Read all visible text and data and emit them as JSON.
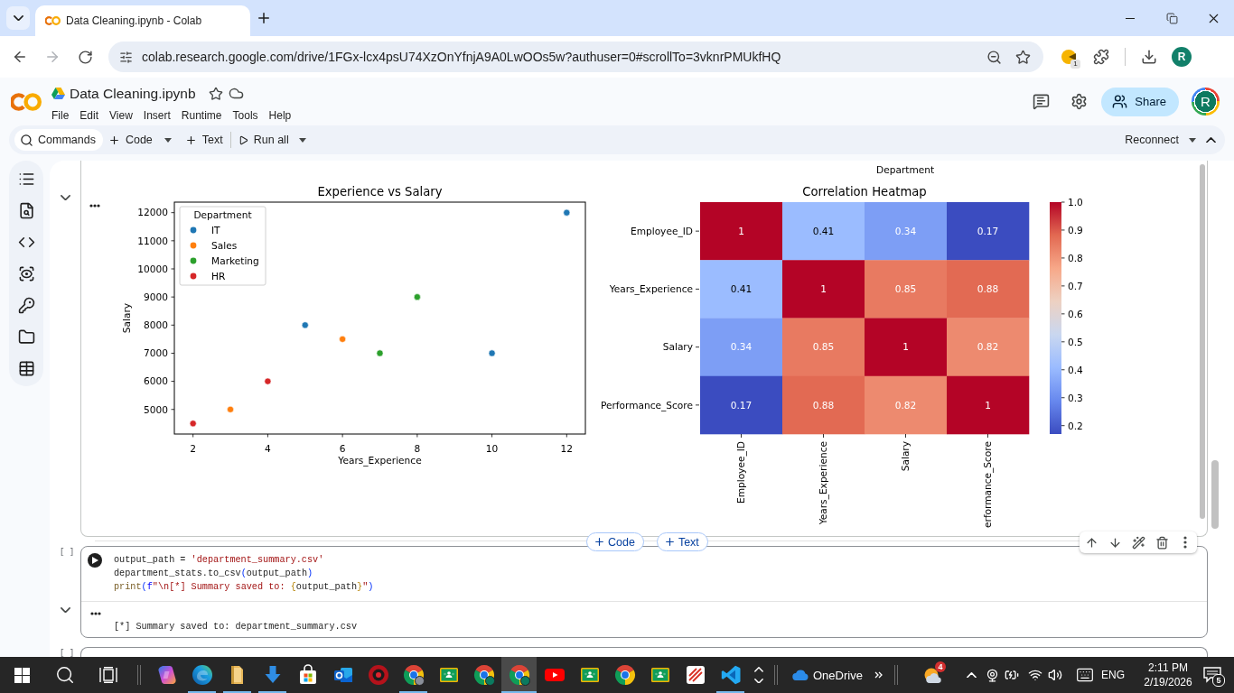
{
  "browser": {
    "tabs": [
      {
        "title": "Data Cleaning.ipynb - Colab",
        "selected": true
      }
    ],
    "can_go_forward": false,
    "url": "colab.research.google.com/drive/1FGx-lcx4psU74XzOnYfnjA9A0LwOOs5w?authuser=0#scrollTo=3vknrPMUkfHQ",
    "url_starred": false,
    "extension_badge": "1",
    "profile_initial": "R"
  },
  "header": {
    "title": "Data Cleaning.ipynb",
    "starred": false,
    "menu": [
      "File",
      "Edit",
      "View",
      "Insert",
      "Runtime",
      "Tools",
      "Help"
    ],
    "share": "Share",
    "avatar_initial": "R"
  },
  "toolbar": {
    "commands": "Commands",
    "add_code": "Code",
    "add_text": "Text",
    "run_all": "Run all",
    "runtime_status": "Reconnect"
  },
  "cells": [
    {
      "kind": "output",
      "output_expanded": true,
      "partial_label": "Department",
      "charts": [
        {
          "chart_data": {
            "type": "scatter",
            "title": "Experience vs Salary",
            "xlabel": "Years_Experience",
            "ylabel": "Salary",
            "legend": {
              "title": "Department"
            },
            "series": [
              {
                "name": "IT",
                "color": "#1f77b4",
                "x": [
                  5,
                  10,
                  12
                ],
                "values": [
                  8000,
                  7000,
                  12000
                ]
              },
              {
                "name": "Sales",
                "color": "#ff7f0e",
                "x": [
                  3,
                  6
                ],
                "values": [
                  5000,
                  7500
                ]
              },
              {
                "name": "Marketing",
                "color": "#2ca02c",
                "x": [
                  7,
                  8
                ],
                "values": [
                  7000,
                  9000
                ]
              },
              {
                "name": "HR",
                "color": "#d62728",
                "x": [
                  2,
                  4
                ],
                "values": [
                  4500,
                  6000
                ]
              }
            ],
            "xlim": [
              1.5,
              12.5
            ],
            "ylim": [
              4125,
              12375
            ],
            "xticks": [
              {
                "value": 2,
                "label": "2"
              },
              {
                "value": 4,
                "label": "4"
              },
              {
                "value": 6,
                "label": "6"
              },
              {
                "value": 8,
                "label": "8"
              },
              {
                "value": 10,
                "label": "10"
              },
              {
                "value": 12,
                "label": "12"
              }
            ],
            "yticks": [
              {
                "value": 5000,
                "label": "5000"
              },
              {
                "value": 6000,
                "label": "6000"
              },
              {
                "value": 7000,
                "label": "7000"
              },
              {
                "value": 8000,
                "label": "8000"
              },
              {
                "value": 9000,
                "label": "9000"
              },
              {
                "value": 10000,
                "label": "10000"
              },
              {
                "value": 11000,
                "label": "11000"
              },
              {
                "value": 12000,
                "label": "12000"
              }
            ]
          }
        }
      ],
      "heatmap": {
        "title": "Correlation Heatmap",
        "matrix": [
          {
            "label": "Employee_ID",
            "squares": [
              {
                "text": "1",
                "color": "#b40426"
              },
              {
                "text": "0.41",
                "color": "#9bbcff"
              },
              {
                "text": "0.34",
                "color": "#7d9ef5"
              },
              {
                "text": "0.17",
                "color": "#3b4cc0"
              }
            ]
          },
          {
            "label": "Years_Experience",
            "squares": [
              {
                "text": "0.41",
                "color": "#9bbcff"
              },
              {
                "text": "1",
                "color": "#b40426"
              },
              {
                "text": "0.85",
                "color": "#e87a61"
              },
              {
                "text": "0.88",
                "color": "#e26a53"
              }
            ]
          },
          {
            "label": "Salary",
            "squares": [
              {
                "text": "0.34",
                "color": "#7d9ef5"
              },
              {
                "text": "0.85",
                "color": "#e87a61"
              },
              {
                "text": "1",
                "color": "#b40426"
              },
              {
                "text": "0.82",
                "color": "#ed8a6f"
              }
            ]
          },
          {
            "label": "Performance_Score",
            "squares": [
              {
                "text": "0.17",
                "color": "#3b4cc0"
              },
              {
                "text": "0.88",
                "color": "#e26a53"
              },
              {
                "text": "0.82",
                "color": "#ed8a6f"
              },
              {
                "text": "1",
                "color": "#b40426"
              }
            ]
          }
        ],
        "x_axis_labels": [
          "Employee_ID",
          "Years_Experience",
          "Salary",
          "erformance_Score"
        ],
        "colorbar_ticks": [
          "1.0",
          "0.9",
          "0.8",
          "0.7",
          "0.6",
          "0.5",
          "0.4",
          "0.3",
          "0.2"
        ]
      }
    },
    {
      "kind": "code",
      "prompt": "[ ]",
      "code_lines": [
        [
          {
            "text": "output_path = ",
            "kind": "plain"
          },
          {
            "text": "'department_summary.csv'",
            "kind": "string"
          }
        ],
        [
          {
            "text": "department_stats.to_csv",
            "kind": "plain"
          },
          {
            "text": "(",
            "kind": "bracket"
          },
          {
            "text": "output_path",
            "kind": "plain"
          },
          {
            "text": ")",
            "kind": "bracket"
          }
        ],
        [
          {
            "text": "print",
            "kind": "function"
          },
          {
            "text": "(",
            "kind": "bracket"
          },
          {
            "text": "f",
            "kind": "keyword"
          },
          {
            "text": "\"\\n[*] Summary saved to: ",
            "kind": "string"
          },
          {
            "text": "{",
            "kind": "brace"
          },
          {
            "text": "output_path",
            "kind": "plain"
          },
          {
            "text": "}",
            "kind": "brace"
          },
          {
            "text": "\"",
            "kind": "string"
          },
          {
            "text": ")",
            "kind": "bracket"
          }
        ]
      ],
      "output_expanded": true,
      "output": "[*] Summary saved to: department_summary.csv"
    },
    {
      "kind": "code",
      "prompt": "[ ]"
    }
  ],
  "insert_buttons": {
    "code": "Code",
    "text": "Text"
  },
  "taskbar": {
    "apps": [
      {
        "kind": "copilot",
        "running": false,
        "selected": false
      },
      {
        "kind": "edge",
        "running": true,
        "selected": false
      },
      {
        "kind": "explorer",
        "running": true,
        "selected": false
      },
      {
        "kind": "downloads",
        "running": true,
        "selected": false
      },
      {
        "kind": "store",
        "running": false,
        "selected": false
      },
      {
        "kind": "outlook",
        "running": false,
        "selected": false
      },
      {
        "kind": "emblem",
        "running": false,
        "selected": false
      },
      {
        "kind": "chrome_photo",
        "running": true,
        "selected": false
      },
      {
        "kind": "classroom",
        "running": false,
        "selected": false
      },
      {
        "kind": "chrome_badge",
        "running": false,
        "selected": false
      },
      {
        "kind": "chrome_badge",
        "running": true,
        "selected": true
      },
      {
        "kind": "youtube",
        "running": false,
        "selected": false
      },
      {
        "kind": "classroom",
        "running": false,
        "selected": false
      },
      {
        "kind": "chrome",
        "running": false,
        "selected": false
      },
      {
        "kind": "classroom",
        "running": false,
        "selected": false
      },
      {
        "kind": "sketch",
        "running": false,
        "selected": false
      },
      {
        "kind": "vscode",
        "running": true,
        "selected": false
      }
    ],
    "onedrive": "OneDrive",
    "weather_badge": "4",
    "language": "ENG",
    "time": "2:11 PM",
    "date": "2/19/2026",
    "notification_count": "5"
  }
}
